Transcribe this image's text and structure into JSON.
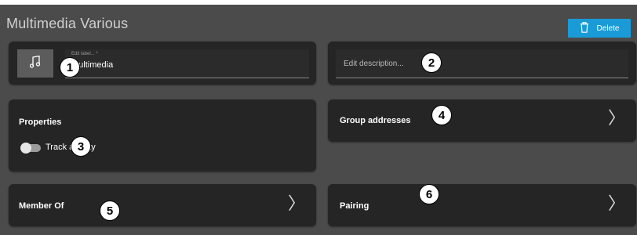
{
  "header": {
    "title": "Multimedia Various",
    "delete_label": "Delete"
  },
  "label_field": {
    "floating_label": "Edit label... *",
    "value": "Multimedia"
  },
  "description_field": {
    "placeholder": "Edit description..."
  },
  "properties": {
    "title": "Properties",
    "toggle_label": "Track activity",
    "toggle_on": false
  },
  "cards": {
    "group_addresses": "Group addresses",
    "member_of": "Member Of",
    "pairing": "Pairing"
  },
  "badges": [
    "1",
    "2",
    "3",
    "4",
    "5",
    "6"
  ],
  "colors": {
    "background": "#4b4b4b",
    "card": "#252525",
    "accent": "#1a9bd7"
  },
  "icons": {
    "item_icon": "music-note-icon",
    "delete_icon": "trash-icon",
    "chevron": "chevron-right-icon"
  }
}
